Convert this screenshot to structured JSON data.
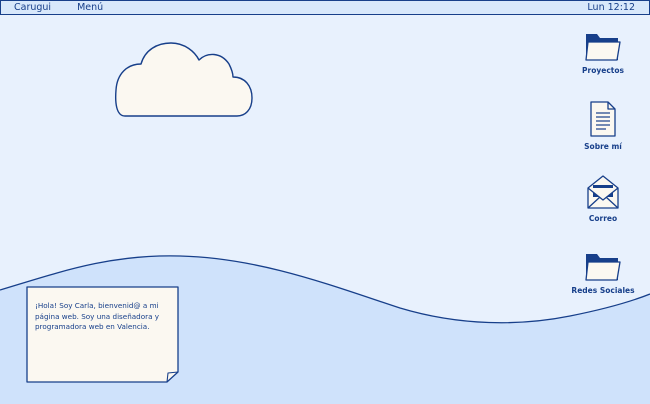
{
  "menubar": {
    "brand": "Carugui",
    "menu_label": "Menú",
    "clock": "Lun 12:12"
  },
  "desktop_icons": [
    {
      "label": "Proyectos",
      "icon": "folder-icon"
    },
    {
      "label": "Sobre mí",
      "icon": "document-icon"
    },
    {
      "label": "Correo",
      "icon": "mail-icon"
    },
    {
      "label": "Redes Sociales",
      "icon": "folder-icon"
    }
  ],
  "note": {
    "text": "¡Hola! Soy Carla, bienvenid@ a mi página web. Soy una diseñadora y programadora web en Valencia."
  },
  "colors": {
    "background": "#e8f1fd",
    "lower_area": "#cfe2fb",
    "accent": "#173f8a",
    "note_paper": "#fbf8f1"
  }
}
